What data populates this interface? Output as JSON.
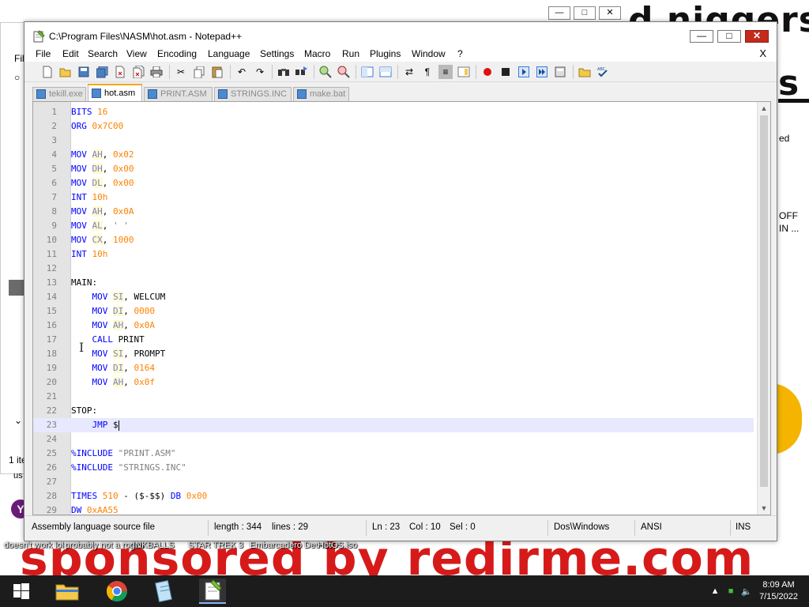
{
  "background": {
    "title_fragment": "d niggers",
    "letter_s": "s",
    "sponsor_text": "sponsored by redirme.com",
    "right_labels": [
      "ed",
      "OFF",
      "IN ..."
    ],
    "left_labels": [
      "Fil",
      "1 ite",
      "us"
    ],
    "desktop_icons": [
      {
        "label": "doesn't work lol"
      },
      {
        "label": "probably not a rogue"
      },
      {
        "label": "INKBALLS"
      },
      {
        "label": "STAR TREK 3"
      },
      {
        "label": "Embarcadero Dev-C++"
      },
      {
        "label": "HotOS.iso"
      }
    ]
  },
  "window": {
    "title": "C:\\Program Files\\NASM\\hot.asm - Notepad++",
    "controls": [
      "minimize",
      "maximize",
      "close"
    ]
  },
  "menu": [
    "File",
    "Edit",
    "Search",
    "View",
    "Encoding",
    "Language",
    "Settings",
    "Macro",
    "Run",
    "Plugins",
    "Window",
    "?"
  ],
  "menu_close": "X",
  "tabs": [
    {
      "label": "tekill.exe",
      "active": false
    },
    {
      "label": "hot.asm",
      "active": true
    },
    {
      "label": "PRINT.ASM",
      "active": false
    },
    {
      "label": "STRINGS.INC",
      "active": false
    },
    {
      "label": "make.bat",
      "active": false
    }
  ],
  "editor": {
    "current_line": 23,
    "lines": [
      {
        "n": "1"
      },
      {
        "n": "2"
      },
      {
        "n": "3"
      },
      {
        "n": "4"
      },
      {
        "n": "5"
      },
      {
        "n": "6"
      },
      {
        "n": "7"
      },
      {
        "n": "8"
      },
      {
        "n": "9"
      },
      {
        "n": "10"
      },
      {
        "n": "11"
      },
      {
        "n": "12"
      },
      {
        "n": "13"
      },
      {
        "n": "14"
      },
      {
        "n": "15"
      },
      {
        "n": "16"
      },
      {
        "n": "17"
      },
      {
        "n": "18"
      },
      {
        "n": "19"
      },
      {
        "n": "20"
      },
      {
        "n": "21"
      },
      {
        "n": "22"
      },
      {
        "n": "23"
      },
      {
        "n": "24"
      },
      {
        "n": "25"
      },
      {
        "n": "26"
      },
      {
        "n": "27"
      },
      {
        "n": "28"
      },
      {
        "n": "29"
      }
    ],
    "code": {
      "l1": [
        "BITS",
        "16"
      ],
      "l2": [
        "ORG",
        "0x7C00"
      ],
      "l4": [
        "MOV",
        "AH",
        ", ",
        "0x02"
      ],
      "l5": [
        "MOV",
        "DH",
        ", ",
        "0x00"
      ],
      "l6": [
        "MOV",
        "DL",
        ", ",
        "0x00"
      ],
      "l7": [
        "INT",
        "10h"
      ],
      "l8": [
        "MOV",
        "AH",
        ", ",
        "0x0A"
      ],
      "l9": [
        "MOV",
        "AL",
        ", ",
        "' '"
      ],
      "l10": [
        "MOV",
        "CX",
        ", ",
        "1000"
      ],
      "l11": [
        "INT",
        "10h"
      ],
      "l13": [
        "MAIN:"
      ],
      "l14": [
        "MOV",
        "SI",
        ", WELCUM"
      ],
      "l15": [
        "MOV",
        "DI",
        ", ",
        "0000"
      ],
      "l16": [
        "MOV",
        "AH",
        ", ",
        "0x0A"
      ],
      "l17": [
        "CALL",
        " PRINT"
      ],
      "l18": [
        "MOV",
        "SI",
        ", PROMPT"
      ],
      "l19": [
        "MOV",
        "DI",
        ", ",
        "0164"
      ],
      "l20": [
        "MOV",
        "AH",
        ", ",
        "0x0f"
      ],
      "l22": [
        "STOP:"
      ],
      "l23": [
        "JMP",
        "$"
      ],
      "l25": [
        "%INCLUDE",
        "\"PRINT.ASM\""
      ],
      "l26": [
        "%INCLUDE",
        "\"STRINGS.INC\""
      ],
      "l28": [
        "TIMES",
        "510",
        " - ($-$$) ",
        "DB",
        "0x00"
      ],
      "l29": [
        "DW",
        "0xAA55"
      ]
    }
  },
  "status": {
    "file_type": "Assembly language source file",
    "length": "length : 344",
    "lines": "lines : 29",
    "ln": "Ln : 23",
    "col": "Col : 10",
    "sel": "Sel : 0",
    "eol": "Dos\\Windows",
    "encoding": "ANSI",
    "mode": "INS"
  },
  "taskbar": {
    "time": "8:09 AM",
    "date": "7/15/2022",
    "apps": [
      "start-button",
      "file-explorer",
      "chrome",
      "notepad",
      "notepad-plus-plus"
    ]
  },
  "colors": {
    "keyword": "#0000ff",
    "register": "#8080c0",
    "number": "#ff8000",
    "string": "#808080",
    "current_line": "#e8e8ff",
    "sponsor": "#d61a1a",
    "close_button": "#c42b1c"
  }
}
